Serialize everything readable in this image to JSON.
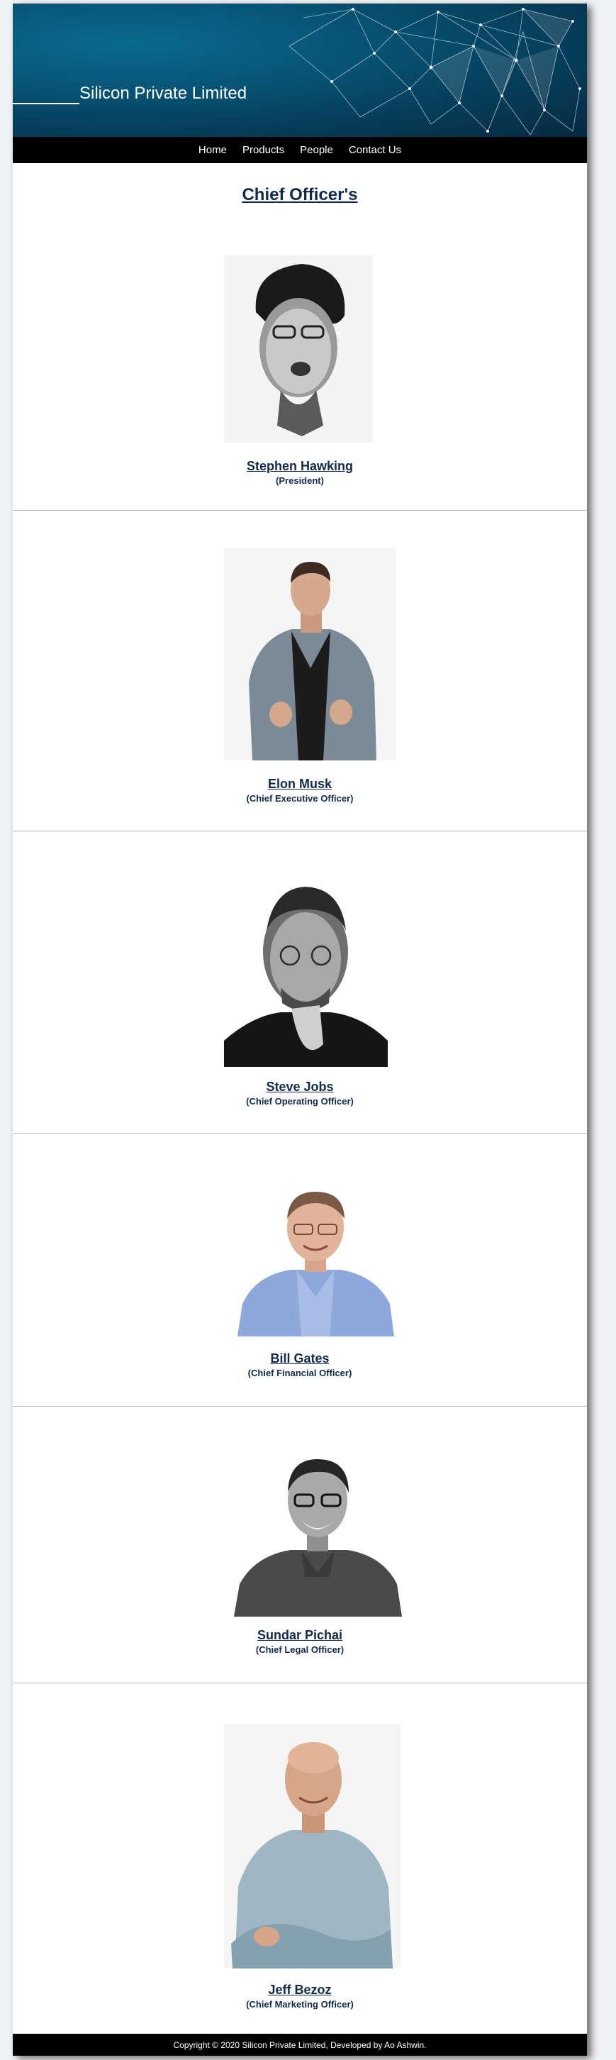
{
  "site": {
    "brand": "Silicon Private Limited"
  },
  "nav": {
    "items": [
      "Home",
      "Products",
      "People",
      "Contact Us"
    ]
  },
  "heading": "Chief Officer's",
  "officers": [
    {
      "name": "Stephen Hawking",
      "role": "(President)",
      "photo": "stephen-hawking-portrait"
    },
    {
      "name": "Elon Musk",
      "role": "(Chief Executive Officer)",
      "photo": "elon-musk-portrait"
    },
    {
      "name": "Steve Jobs",
      "role": "(Chief Operating Officer)",
      "photo": "steve-jobs-portrait"
    },
    {
      "name": "Bill Gates",
      "role": "(Chief Financial Officer)",
      "photo": "bill-gates-portrait"
    },
    {
      "name": "Sundar Pichai",
      "role": "(Chief Legal Officer)",
      "photo": "sundar-pichai-portrait"
    },
    {
      "name": "Jeff Bezoz",
      "role": "(Chief Marketing Officer)",
      "photo": "jeff-bezos-portrait"
    }
  ],
  "footer": {
    "text": "Copyright © 2020 Silicon Private Limited, Developed by Ao Ashwin."
  },
  "colors": {
    "banner": "#075475",
    "nav": "#000000",
    "heading": "#13294b"
  }
}
